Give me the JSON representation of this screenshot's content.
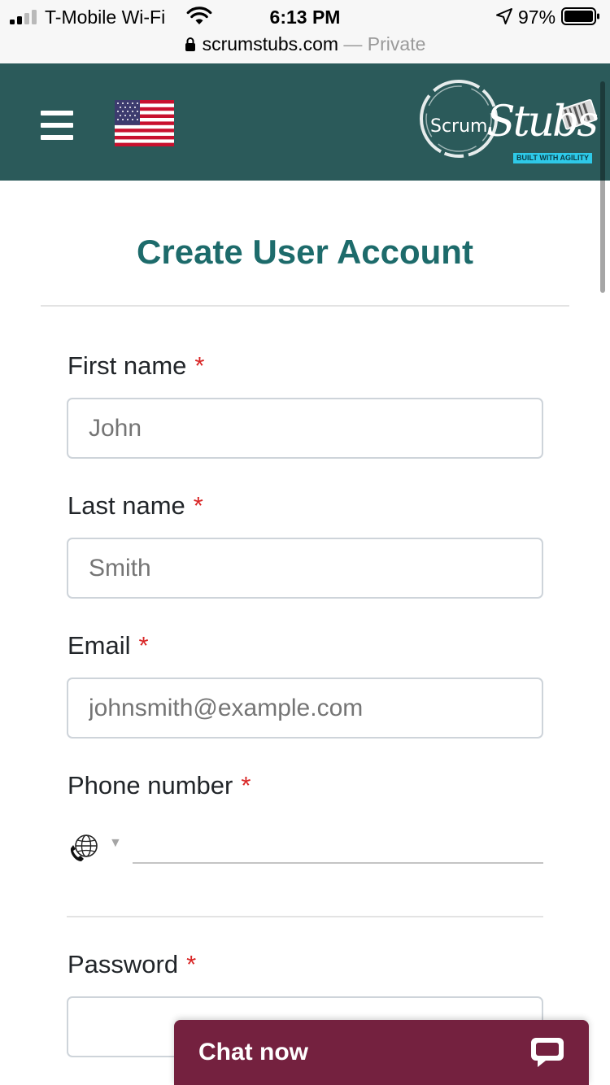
{
  "status_bar": {
    "carrier": "T-Mobile Wi-Fi",
    "time": "6:13 PM",
    "battery": "97%",
    "signal_icon": "cellular-signal-icon",
    "wifi_icon": "wifi-icon",
    "location_icon": "location-arrow-icon",
    "battery_icon": "battery-icon"
  },
  "browser": {
    "domain": "scrumstubs.com",
    "mode": " — Private",
    "lock_icon": "lock-icon"
  },
  "header": {
    "menu_icon": "hamburger-menu-icon",
    "flag_icon": "us-flag-icon",
    "logo": {
      "text_main": "Scrum",
      "text_script": "Stubs",
      "tagline": "BUILT WITH AGILITY"
    },
    "background_color": "#2b5a5a"
  },
  "form": {
    "title": "Create User Account",
    "title_color": "#1d6b6b",
    "required_mark": "*",
    "required_color": "#d92626",
    "fields": {
      "first_name": {
        "label": "First name",
        "placeholder": "John",
        "value": ""
      },
      "last_name": {
        "label": "Last name",
        "placeholder": "Smith",
        "value": ""
      },
      "email": {
        "label": "Email",
        "placeholder": "johnsmith@example.com",
        "value": ""
      },
      "phone": {
        "label": "Phone number",
        "country_icon": "globe-phone-icon",
        "value": ""
      },
      "password": {
        "label": "Password",
        "value": ""
      }
    }
  },
  "chat": {
    "label": "Chat now",
    "icon": "chat-bubble-icon",
    "background_color": "#74213f"
  }
}
